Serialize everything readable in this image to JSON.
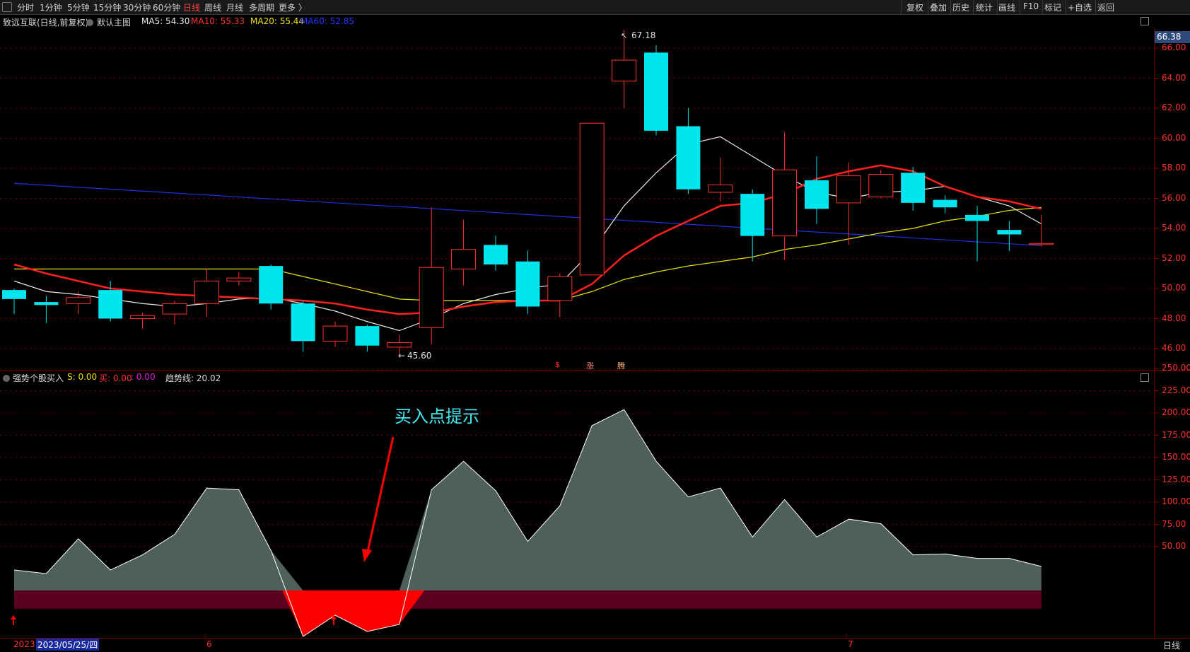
{
  "toolbar": {
    "periods": [
      "分时",
      "1分钟",
      "5分钟",
      "15分钟",
      "30分钟",
      "60分钟",
      "日线",
      "周线",
      "月线",
      "多周期",
      "更多 〉"
    ],
    "active_period": "日线",
    "right_buttons": [
      "复权",
      "叠加",
      "历史",
      "统计",
      "画线",
      "F10",
      "标记",
      "+自选",
      "返回"
    ]
  },
  "main_chart": {
    "stock_title": "致远互联(日线,前复权)",
    "indicator_name": "默认主图",
    "ma5": "MA5: 54.30",
    "ma10": "MA10: 55.33",
    "ma20": "MA20: 55.44",
    "ma60": "MA60: 52.85",
    "current_price_tag": "66.38",
    "high_label": "67.18",
    "low_label": "45.60",
    "y_axis": [
      "66.00",
      "64.00",
      "62.00",
      "60.00",
      "58.00",
      "56.00",
      "54.00",
      "52.00",
      "50.00",
      "48.00",
      "46.00"
    ],
    "markers": [
      "$",
      "涨",
      "腾"
    ]
  },
  "sub_chart": {
    "indicator_name": "强势个股买入",
    "s_value": "S: 0.00",
    "buy_value": "买: 0.00",
    "colon_value": ": 0.00",
    "trend_value": "趋势线: 20.02",
    "annotation": "买入点提示",
    "y_axis": [
      "250.00",
      "225.00",
      "200.00",
      "175.00",
      "150.00",
      "125.00",
      "100.00",
      "75.00",
      "50.00"
    ]
  },
  "bottom": {
    "date_prefix": "2023",
    "selected_date": "2023/05/25/四",
    "month_6": "6",
    "month_7": "7",
    "period_label": "日线"
  },
  "chart_data": {
    "type": "candlestick",
    "x_start": "2023/05/25",
    "ylim": [
      45,
      67.5
    ],
    "candles": [
      [
        49.9,
        49.3,
        50.0,
        48.3
      ],
      [
        49.1,
        48.9,
        49.5,
        47.7
      ],
      [
        49.0,
        49.4,
        49.8,
        48.3
      ],
      [
        49.9,
        48.0,
        50.5,
        47.8
      ],
      [
        48.0,
        48.2,
        48.4,
        47.3
      ],
      [
        48.3,
        49.0,
        49.2,
        47.6
      ],
      [
        49.0,
        50.5,
        51.3,
        48.1
      ],
      [
        50.5,
        50.7,
        51.1,
        50.2
      ],
      [
        51.5,
        49.0,
        51.6,
        48.6
      ],
      [
        49.0,
        46.5,
        49.2,
        45.8
      ],
      [
        46.5,
        47.5,
        47.8,
        46.1
      ],
      [
        47.5,
        46.2,
        47.6,
        45.8
      ],
      [
        46.1,
        46.4,
        46.9,
        45.6
      ],
      [
        47.4,
        51.4,
        55.4,
        46.3
      ],
      [
        51.3,
        52.6,
        54.6,
        50.2
      ],
      [
        52.9,
        51.6,
        53.5,
        51.2
      ],
      [
        51.8,
        48.8,
        52.5,
        48.3
      ],
      [
        49.2,
        50.8,
        51.0,
        48.1
      ],
      [
        50.9,
        61.0,
        61.0,
        50.9
      ],
      [
        63.8,
        65.2,
        67.2,
        62.0
      ],
      [
        65.7,
        60.5,
        66.2,
        60.2
      ],
      [
        60.8,
        56.6,
        62.0,
        56.3
      ],
      [
        56.4,
        56.9,
        58.7,
        55.8
      ],
      [
        56.3,
        53.5,
        56.6,
        51.8
      ],
      [
        53.5,
        57.9,
        60.4,
        51.9
      ],
      [
        57.2,
        55.3,
        58.8,
        54.3
      ],
      [
        55.7,
        57.5,
        58.4,
        52.9
      ],
      [
        56.1,
        57.6,
        57.9,
        56.0
      ],
      [
        57.7,
        55.7,
        58.1,
        55.2
      ],
      [
        55.9,
        55.4,
        56.2,
        55.0
      ],
      [
        54.9,
        54.5,
        55.5,
        51.8
      ],
      [
        53.9,
        53.6,
        54.5,
        52.5
      ],
      [
        53.0,
        53.0,
        54.9,
        52.8
      ]
    ],
    "ma5": [
      50.5,
      49.8,
      49.6,
      49.3,
      49.0,
      48.8,
      49.0,
      49.3,
      49.4,
      49.0,
      48.5,
      47.8,
      47.2,
      48.0,
      49.0,
      49.6,
      50.0,
      50.3,
      52.5,
      55.5,
      57.7,
      59.6,
      60.1,
      58.8,
      57.5,
      56.4,
      56.0,
      56.4,
      56.5,
      56.8,
      56.1,
      55.5,
      54.3
    ],
    "ma10": [
      51.6,
      51.0,
      50.5,
      50.0,
      49.8,
      49.6,
      49.5,
      49.4,
      49.3,
      49.2,
      49.0,
      48.6,
      48.3,
      48.4,
      48.8,
      49.1,
      49.2,
      49.2,
      50.3,
      52.2,
      53.5,
      54.5,
      55.5,
      55.7,
      56.3,
      57.3,
      57.8,
      58.2,
      57.8,
      56.8,
      56.1,
      55.8,
      55.3
    ],
    "ma20": [
      51.3,
      51.3,
      51.3,
      51.3,
      51.3,
      51.3,
      51.3,
      51.3,
      51.3,
      50.8,
      50.3,
      49.8,
      49.3,
      49.2,
      49.2,
      49.2,
      49.2,
      49.2,
      49.8,
      50.6,
      51.1,
      51.5,
      51.8,
      52.1,
      52.6,
      52.9,
      53.3,
      53.7,
      54.0,
      54.5,
      54.8,
      55.2,
      55.4
    ],
    "ma60_start": 57.0,
    "ma60_end": 52.85,
    "trend_line": [
      23,
      19,
      58,
      23,
      40,
      63,
      115,
      113,
      45,
      0,
      0,
      0,
      0,
      113,
      145,
      112,
      55,
      95,
      185,
      203,
      145,
      105,
      115,
      60,
      102,
      60,
      80,
      75,
      40,
      41,
      36,
      36,
      27
    ]
  },
  "colors": {
    "up": "#ff3030",
    "down": "#00e5ee",
    "ma5": "#e8e8e8",
    "ma10": "#ff2020",
    "ma20": "#e8e000",
    "ma60": "#2030e0",
    "area": "#4e6058",
    "band": "#5a0020",
    "signal": "#ff0000",
    "annotation": "#40e8f0"
  }
}
